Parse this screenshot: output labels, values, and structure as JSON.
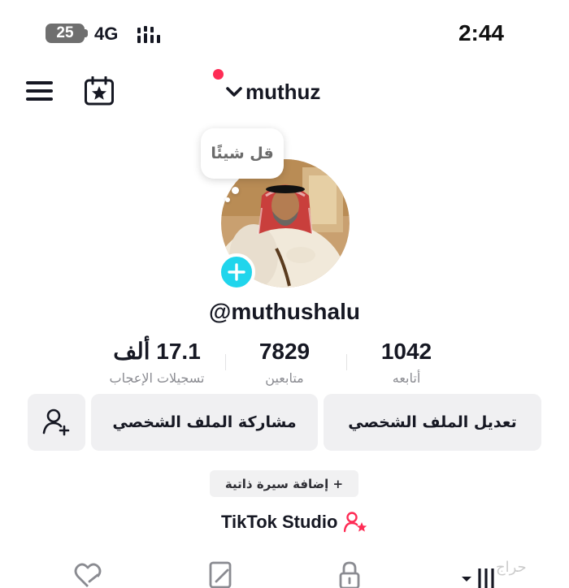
{
  "status_bar": {
    "battery": "25",
    "network": "4G",
    "time": "2:44"
  },
  "header": {
    "account_name": "muthuz",
    "icons": [
      "menu-icon",
      "calendar-star-icon",
      "chevron-down-icon"
    ],
    "notification_dot_color": "#fe2c55"
  },
  "profile": {
    "bubble_text": "قل شيئًا",
    "username": "@muthushalu",
    "add_photo_color": "#20d5ec"
  },
  "stats": [
    {
      "value": "17.1 ألف",
      "label": "تسجيلات الإعجاب"
    },
    {
      "value": "7829",
      "label": "متابعين"
    },
    {
      "value": "1042",
      "label": "أتابعه"
    }
  ],
  "actions": {
    "edit_profile": "تعديل الملف الشخصي",
    "share_profile": "مشاركة الملف الشخصي",
    "add_friend_icon": "add-user-icon"
  },
  "bio": {
    "add_bio": "+ إضافة سيرة ذاتية"
  },
  "studio": {
    "label": "TikTok Studio",
    "icon_color": "#fe2c55"
  },
  "tabs": [
    "liked-icon",
    "reposts-icon",
    "lock-icon",
    "grid-icon"
  ],
  "watermark": "حراج"
}
